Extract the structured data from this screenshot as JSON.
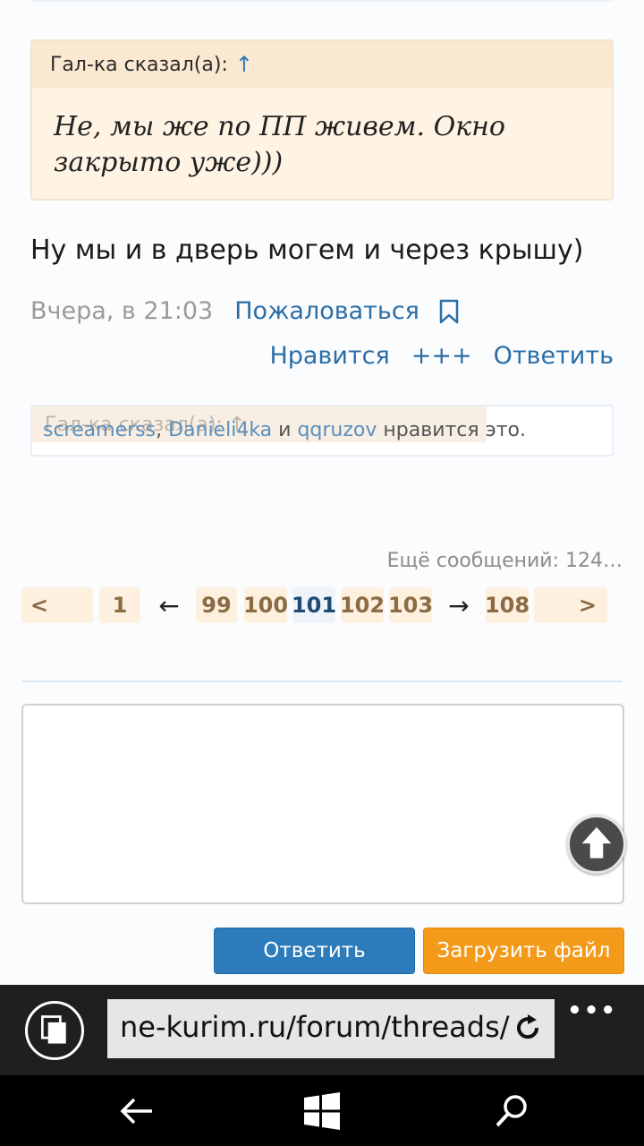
{
  "quote": {
    "author_label": "Гал-ка сказал(а):",
    "arrow": "↑",
    "text": "Не, мы же по ПП живем. Окно закрыто уже)))"
  },
  "post": {
    "text": "Ну мы и в дверь могем и через крышу)",
    "time": "Вчера, в 21:03",
    "report": "Пожаловаться"
  },
  "actions": {
    "like": "Нравится",
    "plus": "+++",
    "reply": "Ответить"
  },
  "likes": {
    "ghost_text": "Гал-ка сказал(а): ↑",
    "users": [
      "screamerss",
      "Danieli4ka",
      "qqruzov"
    ],
    "sep_comma": ", ",
    "sep_and": " и ",
    "suffix": " нравится это."
  },
  "more_messages": "Ещё сообщений: 124…",
  "pagination": {
    "prev": "<",
    "first": "1",
    "left_arrow": "←",
    "p99": "99",
    "p100": "100",
    "p101": "101",
    "p102": "102",
    "p103": "103",
    "right_arrow": "→",
    "last": "108",
    "next": ">",
    "current": "101"
  },
  "editor": {
    "value": ""
  },
  "buttons": {
    "reply": "Ответить",
    "upload": "Загрузить файл"
  },
  "browser": {
    "url": "ne-kurim.ru/forum/threads/",
    "menu_dots": "•••"
  },
  "colors": {
    "link": "#2b6ea6",
    "quote_bg": "#fff3e3",
    "reply_button": "#2d7bbb",
    "upload_button": "#f39a1a"
  }
}
